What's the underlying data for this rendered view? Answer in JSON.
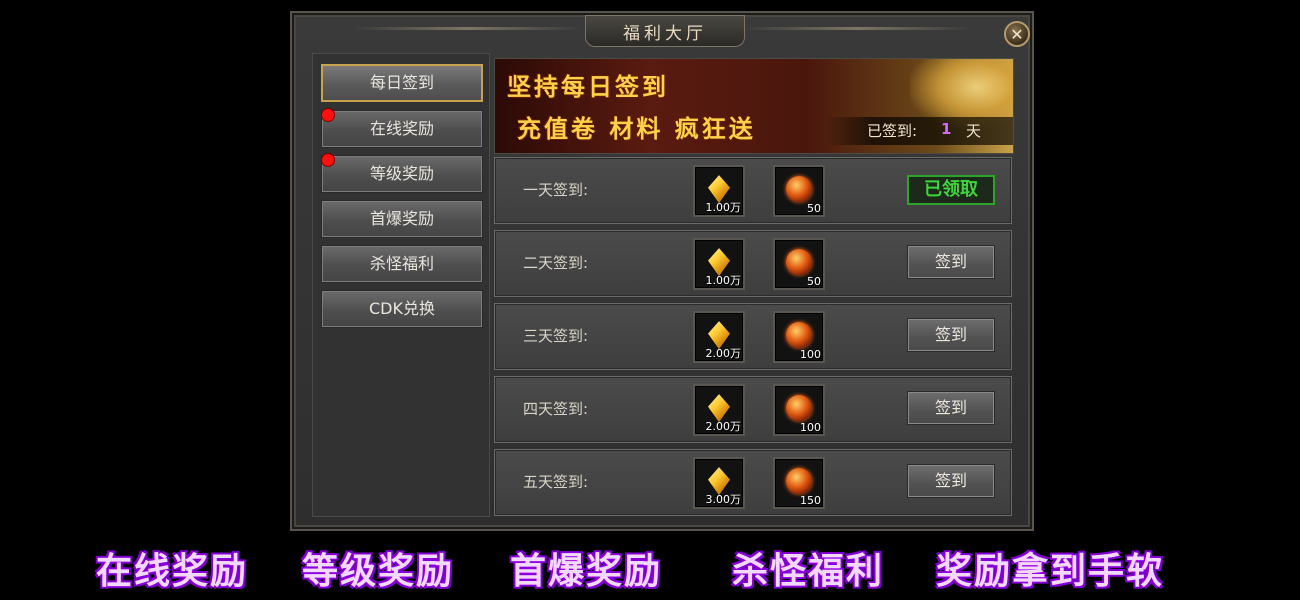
{
  "window": {
    "title": "福利大厅",
    "close_glyph": "✕"
  },
  "sidebar": {
    "items": [
      {
        "label": "每日签到",
        "active": true,
        "dot": false
      },
      {
        "label": "在线奖励",
        "active": false,
        "dot": true
      },
      {
        "label": "等级奖励",
        "active": false,
        "dot": true
      },
      {
        "label": "首爆奖励",
        "active": false,
        "dot": false
      },
      {
        "label": "杀怪福利",
        "active": false,
        "dot": false
      },
      {
        "label": "CDK兑换",
        "active": false,
        "dot": false
      }
    ]
  },
  "banner": {
    "line1": "坚持每日签到",
    "line2": "充值卷 材料 疯狂送",
    "signed_label": "已签到:",
    "signed_count": "1",
    "signed_unit": "天"
  },
  "rows": [
    {
      "label": "一天签到:",
      "item1_icon": "gold-crystal-icon",
      "item1_qty": "1.00万",
      "item2_icon": "fire-orb-icon",
      "item2_qty": "50",
      "action": "已领取",
      "claimed": true
    },
    {
      "label": "二天签到:",
      "item1_icon": "gold-crystal-icon",
      "item1_qty": "1.00万",
      "item2_icon": "fire-orb-icon",
      "item2_qty": "50",
      "action": "签到",
      "claimed": false
    },
    {
      "label": "三天签到:",
      "item1_icon": "gold-crystal-icon",
      "item1_qty": "2.00万",
      "item2_icon": "fire-orb-icon",
      "item2_qty": "100",
      "action": "签到",
      "claimed": false
    },
    {
      "label": "四天签到:",
      "item1_icon": "gold-crystal-icon",
      "item1_qty": "2.00万",
      "item2_icon": "fire-orb-icon",
      "item2_qty": "100",
      "action": "签到",
      "claimed": false
    },
    {
      "label": "五天签到:",
      "item1_icon": "gold-crystal-icon",
      "item1_qty": "3.00万",
      "item2_icon": "fire-orb-icon",
      "item2_qty": "150",
      "action": "签到",
      "claimed": false
    }
  ],
  "caption": {
    "items": [
      "在线奖励",
      "等级奖励",
      "首爆奖励",
      "杀怪福利",
      "奖励拿到手软"
    ]
  },
  "colors": {
    "accent_gold": "#c8a24c",
    "claimed_green": "#3fd43a",
    "notify_red": "#ff1010",
    "caption_purple": "#7a00c9"
  }
}
